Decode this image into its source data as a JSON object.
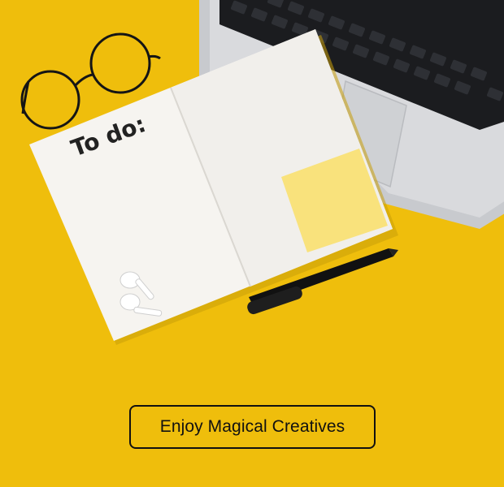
{
  "hero": {
    "todo_text": "To do:"
  },
  "cta": {
    "label": "Enjoy Magical Creatives"
  },
  "colors": {
    "background": "#EFBE0C",
    "button_border": "#111111",
    "sticky_note": "#F9E27C"
  },
  "icons": [
    "glasses-icon",
    "laptop-icon",
    "notebook-icon",
    "sticky-note-icon",
    "pen-icon",
    "earbuds-icon"
  ]
}
